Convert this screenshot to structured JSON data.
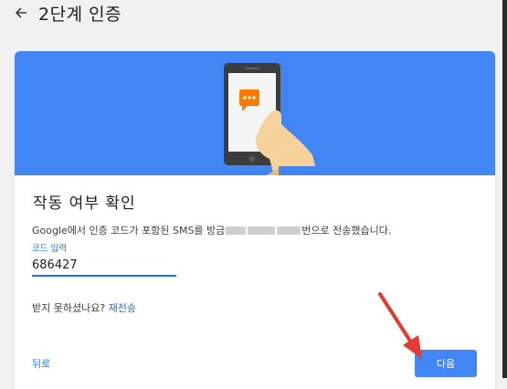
{
  "header": {
    "title": "2단계 인증",
    "back_icon": "arrow-left-icon"
  },
  "colors": {
    "accent": "#4285f4",
    "link": "#1a73e8",
    "annotation_arrow": "#e53935"
  },
  "illustration": {
    "icon": "phone-message-icon"
  },
  "verify": {
    "title": "작동 여부 확인",
    "desc_prefix": "Google에서 인증 코드가 포함된 SMS를 방금",
    "desc_suffix": "번으로 전송했습니다.",
    "code_label": "코드 입력",
    "code_value": "686427",
    "not_received": "받지 못하셨나요?",
    "resend_label": "재전송"
  },
  "actions": {
    "back_label": "뒤로",
    "next_label": "다음"
  }
}
